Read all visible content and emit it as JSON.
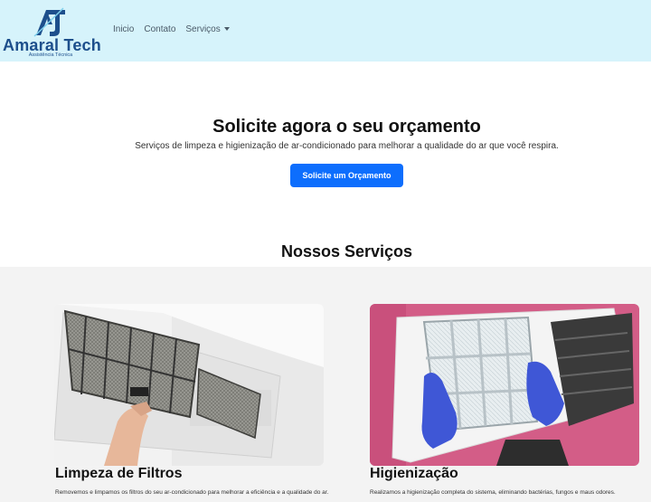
{
  "brand": {
    "monogram": "AT",
    "name": "Amaral Tech",
    "tagline": "Assistência Técnica"
  },
  "nav": {
    "items": [
      {
        "label": "Inicio"
      },
      {
        "label": "Contato"
      },
      {
        "label": "Serviços",
        "dropdown": true
      }
    ]
  },
  "hero": {
    "title": "Solicite agora o seu orçamento",
    "subtitle": "Serviços de limpeza e higienização de ar-condicionado para melhorar a qualidade do ar que você respira.",
    "button": "Solicite um Orçamento"
  },
  "services": {
    "title": "Nossos Serviços",
    "cards": [
      {
        "image": "air-filter-cleaning-photo",
        "title": "Limpeza de Filtros",
        "text": "Removemos e limpamos os filtros do seu ar-condicionado para melhorar a eficiência e a qualidade do ar."
      },
      {
        "image": "air-conditioner-sanitizing-photo",
        "title": "Higienização",
        "text": "Realizamos a higienização completa do sistema, eliminando bactérias, fungos e maus odores."
      }
    ]
  },
  "colors": {
    "navbar_bg": "#d6f3fb",
    "brand": "#1d4f8c",
    "primary": "#0d6efd",
    "section_bg": "#f3f3f3"
  }
}
